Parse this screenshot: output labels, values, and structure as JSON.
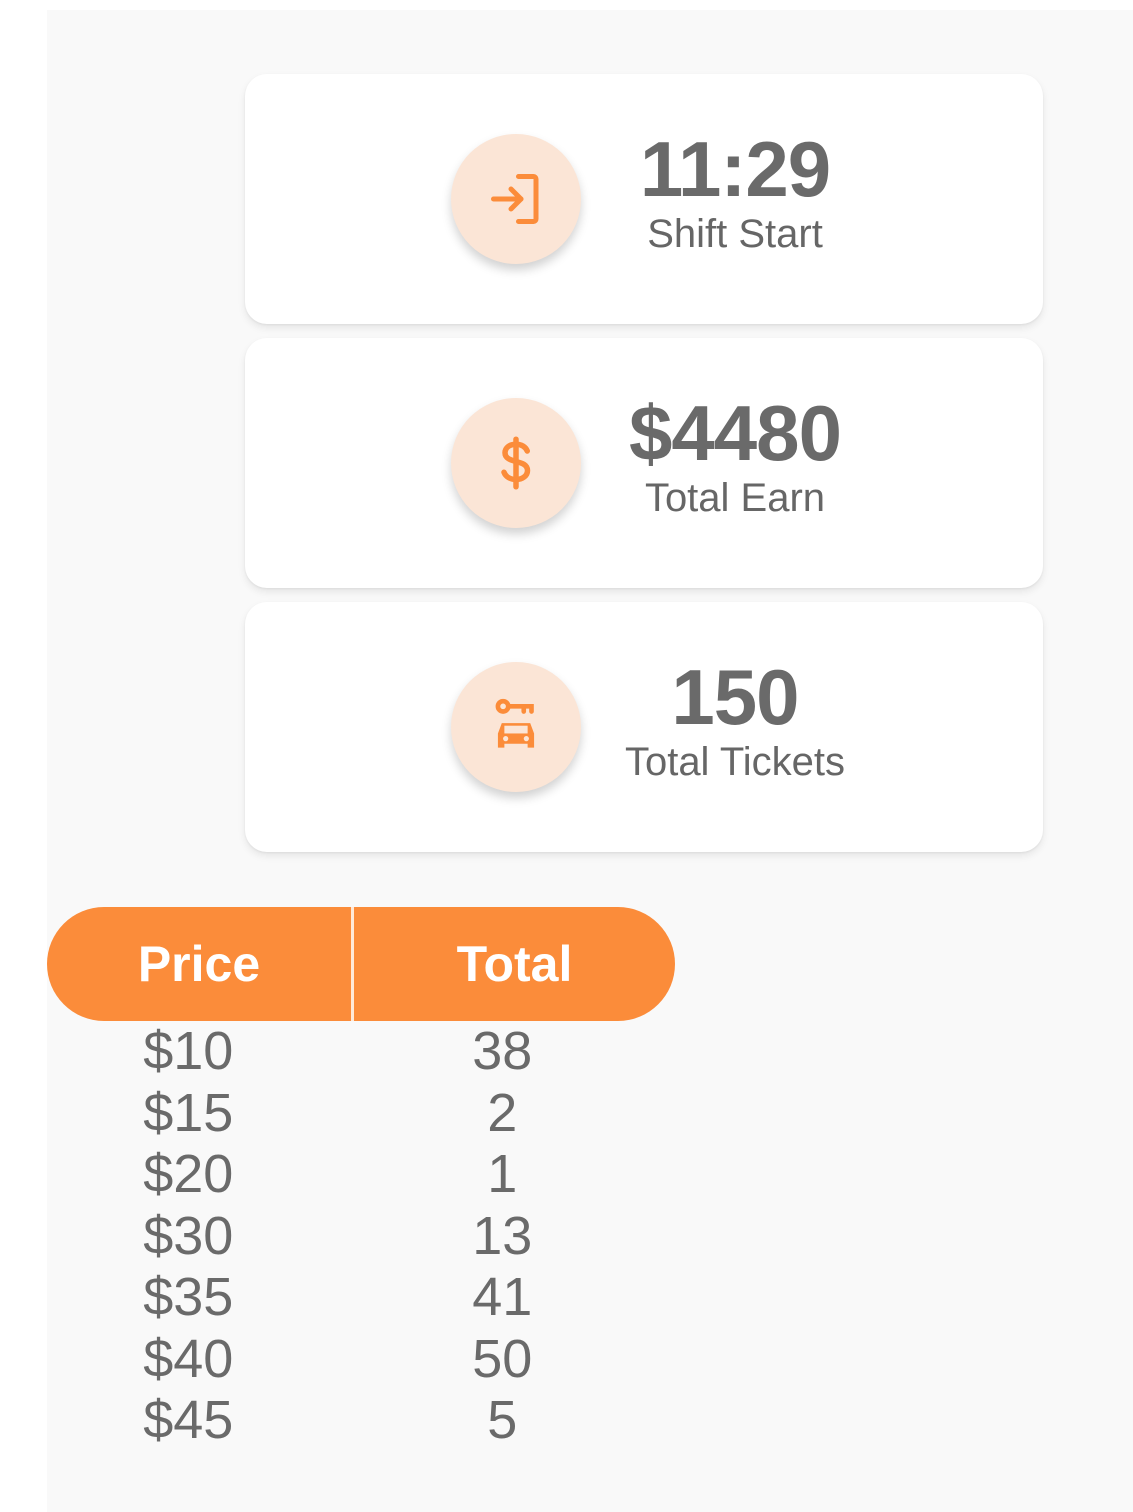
{
  "stats": [
    {
      "value": "11:29",
      "label": "Shift Start",
      "icon": "login-icon"
    },
    {
      "value": "$4480",
      "label": "Total Earn",
      "icon": "dollar-icon"
    },
    {
      "value": "150",
      "label": "Total Tickets",
      "icon": "car-key-icon"
    }
  ],
  "table": {
    "headers": {
      "price": "Price",
      "total": "Total"
    },
    "rows": [
      {
        "price": "$10",
        "total": "38"
      },
      {
        "price": "$15",
        "total": "2"
      },
      {
        "price": "$20",
        "total": "1"
      },
      {
        "price": "$30",
        "total": "13"
      },
      {
        "price": "$35",
        "total": "41"
      },
      {
        "price": "$40",
        "total": "50"
      },
      {
        "price": "$45",
        "total": "5"
      }
    ]
  },
  "colors": {
    "accent": "#fb8c3a",
    "icon_bg": "#fbe5d6",
    "text": "#6a6a6a",
    "background": "#f9f9f9"
  }
}
